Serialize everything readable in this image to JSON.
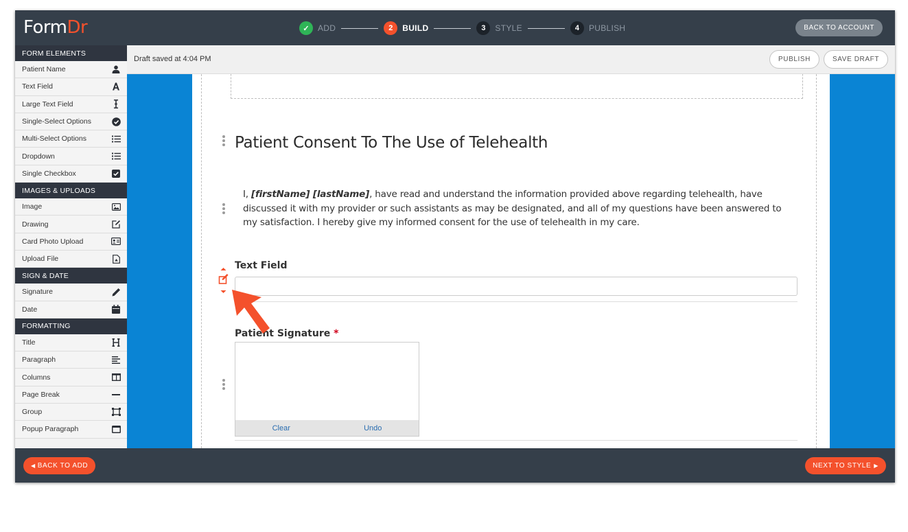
{
  "app": {
    "logo_form": "Form",
    "logo_dr": "Dr"
  },
  "steps": [
    {
      "num": "✓",
      "label": "ADD",
      "state": "done"
    },
    {
      "num": "2",
      "label": "BUILD",
      "state": "active"
    },
    {
      "num": "3",
      "label": "STYLE",
      "state": "todo"
    },
    {
      "num": "4",
      "label": "PUBLISH",
      "state": "todo"
    }
  ],
  "header": {
    "back_account": "BACK TO ACCOUNT"
  },
  "sidebar": {
    "form_elements": "FORM ELEMENTS",
    "form_items": [
      {
        "label": "Patient Name",
        "icon": "user-icon"
      },
      {
        "label": "Text Field",
        "icon": "letter-a-icon"
      },
      {
        "label": "Large Text Field",
        "icon": "text-cursor-icon"
      },
      {
        "label": "Single-Select Options",
        "icon": "check-circle-icon"
      },
      {
        "label": "Multi-Select Options",
        "icon": "list-icon"
      },
      {
        "label": "Dropdown",
        "icon": "list-icon"
      },
      {
        "label": "Single Checkbox",
        "icon": "checkbox-icon"
      }
    ],
    "images_uploads": "IMAGES & UPLOADS",
    "image_items": [
      {
        "label": "Image",
        "icon": "image-icon"
      },
      {
        "label": "Drawing",
        "icon": "edit-icon"
      },
      {
        "label": "Card Photo Upload",
        "icon": "id-card-icon"
      },
      {
        "label": "Upload File",
        "icon": "file-icon"
      }
    ],
    "sign_date": "SIGN & DATE",
    "sign_items": [
      {
        "label": "Signature",
        "icon": "pencil-icon"
      },
      {
        "label": "Date",
        "icon": "calendar-icon"
      }
    ],
    "formatting": "FORMATTING",
    "format_items": [
      {
        "label": "Title",
        "icon": "heading-icon"
      },
      {
        "label": "Paragraph",
        "icon": "align-left-icon"
      },
      {
        "label": "Columns",
        "icon": "columns-icon"
      },
      {
        "label": "Page Break",
        "icon": "minus-icon"
      },
      {
        "label": "Group",
        "icon": "group-icon"
      },
      {
        "label": "Popup Paragraph",
        "icon": "popup-icon"
      }
    ]
  },
  "toolbar": {
    "draft_status": "Draft saved at 4:04 PM",
    "publish": "PUBLISH",
    "save_draft": "SAVE DRAFT"
  },
  "form": {
    "title": "Patient Consent To The Use of Telehealth",
    "para_prefix": "I, ",
    "para_tokens": "[firstName] [lastName]",
    "para_rest": ", have read and understand the information provided above regarding telehealth, have discussed it with my provider or such assistants as may be designated, and all of my questions have been answered to my satisfaction. I hereby give my informed consent for the use of telehealth in my care.",
    "text_field_label": "Text Field",
    "text_field_value": "",
    "signature_label": "Patient Signature",
    "required_mark": "*",
    "sig_clear": "Clear",
    "sig_undo": "Undo"
  },
  "footer": {
    "back_to_add": "BACK TO ADD",
    "next_to_style": "NEXT TO STYLE"
  },
  "colors": {
    "accent": "#f4512c",
    "header_bg": "#353f4a",
    "canvas_bg": "#0a84d4",
    "done_green": "#2fb457"
  }
}
